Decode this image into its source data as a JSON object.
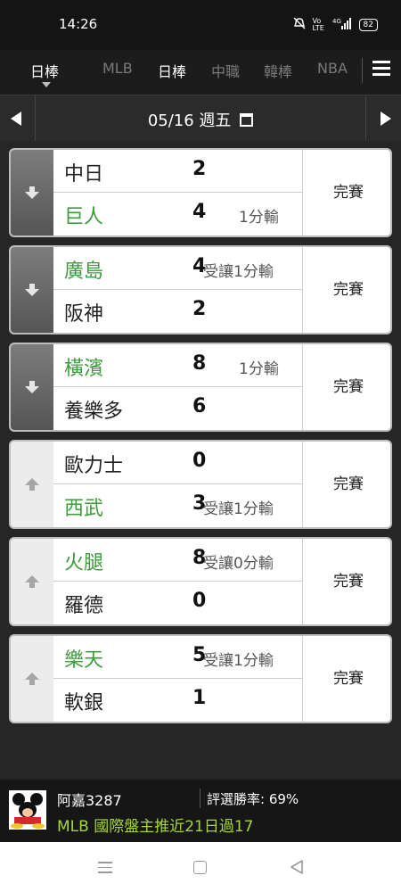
{
  "status_bar": {
    "time": "14:26",
    "icons": [
      "mute-icon",
      "volte-icon",
      "4g-signal-icon",
      "battery-icon"
    ],
    "volte": "Vo LTE",
    "network": "4G",
    "battery": "82"
  },
  "tabs": {
    "items": [
      {
        "label": "日棒"
      },
      {
        "label": "MLB"
      },
      {
        "label": "日棒"
      },
      {
        "label": "中職"
      },
      {
        "label": "韓棒"
      },
      {
        "label": "NBA"
      }
    ]
  },
  "date_bar": {
    "date": "05/16 週五"
  },
  "games": [
    {
      "arrow": "down",
      "rows": [
        {
          "team": "中日",
          "score": "2",
          "note": "",
          "green": false
        },
        {
          "team": "巨人",
          "score": "4",
          "note": "1分輸",
          "green": true
        }
      ],
      "status": "完賽"
    },
    {
      "arrow": "down",
      "rows": [
        {
          "team": "廣島",
          "score": "4",
          "note": "受讓1分輸",
          "green": true
        },
        {
          "team": "阪神",
          "score": "2",
          "note": "",
          "green": false
        }
      ],
      "status": "完賽"
    },
    {
      "arrow": "down",
      "rows": [
        {
          "team": "橫濱",
          "score": "8",
          "note": "1分輸",
          "green": true
        },
        {
          "team": "養樂多",
          "score": "6",
          "note": "",
          "green": false
        }
      ],
      "status": "完賽"
    },
    {
      "arrow": "up",
      "rows": [
        {
          "team": "歐力士",
          "score": "0",
          "note": "",
          "green": false
        },
        {
          "team": "西武",
          "score": "3",
          "note": "受讓1分輸",
          "green": true
        }
      ],
      "status": "完賽"
    },
    {
      "arrow": "up",
      "rows": [
        {
          "team": "火腿",
          "score": "8",
          "note": "受讓0分輸",
          "green": true
        },
        {
          "team": "羅德",
          "score": "0",
          "note": "",
          "green": false
        }
      ],
      "status": "完賽"
    },
    {
      "arrow": "up",
      "rows": [
        {
          "team": "樂天",
          "score": "5",
          "note": "受讓1分輸",
          "green": true
        },
        {
          "team": "軟銀",
          "score": "1",
          "note": "",
          "green": false
        }
      ],
      "status": "完賽"
    }
  ],
  "promo": {
    "name": "阿嘉3287",
    "rate": "評選勝率: 69%",
    "headline": "MLB 國際盤主推近21日過17"
  },
  "colors": {
    "green_team": "#3e9b3e",
    "promo_headline": "#a6d63a",
    "background": "#2a2a2a"
  }
}
